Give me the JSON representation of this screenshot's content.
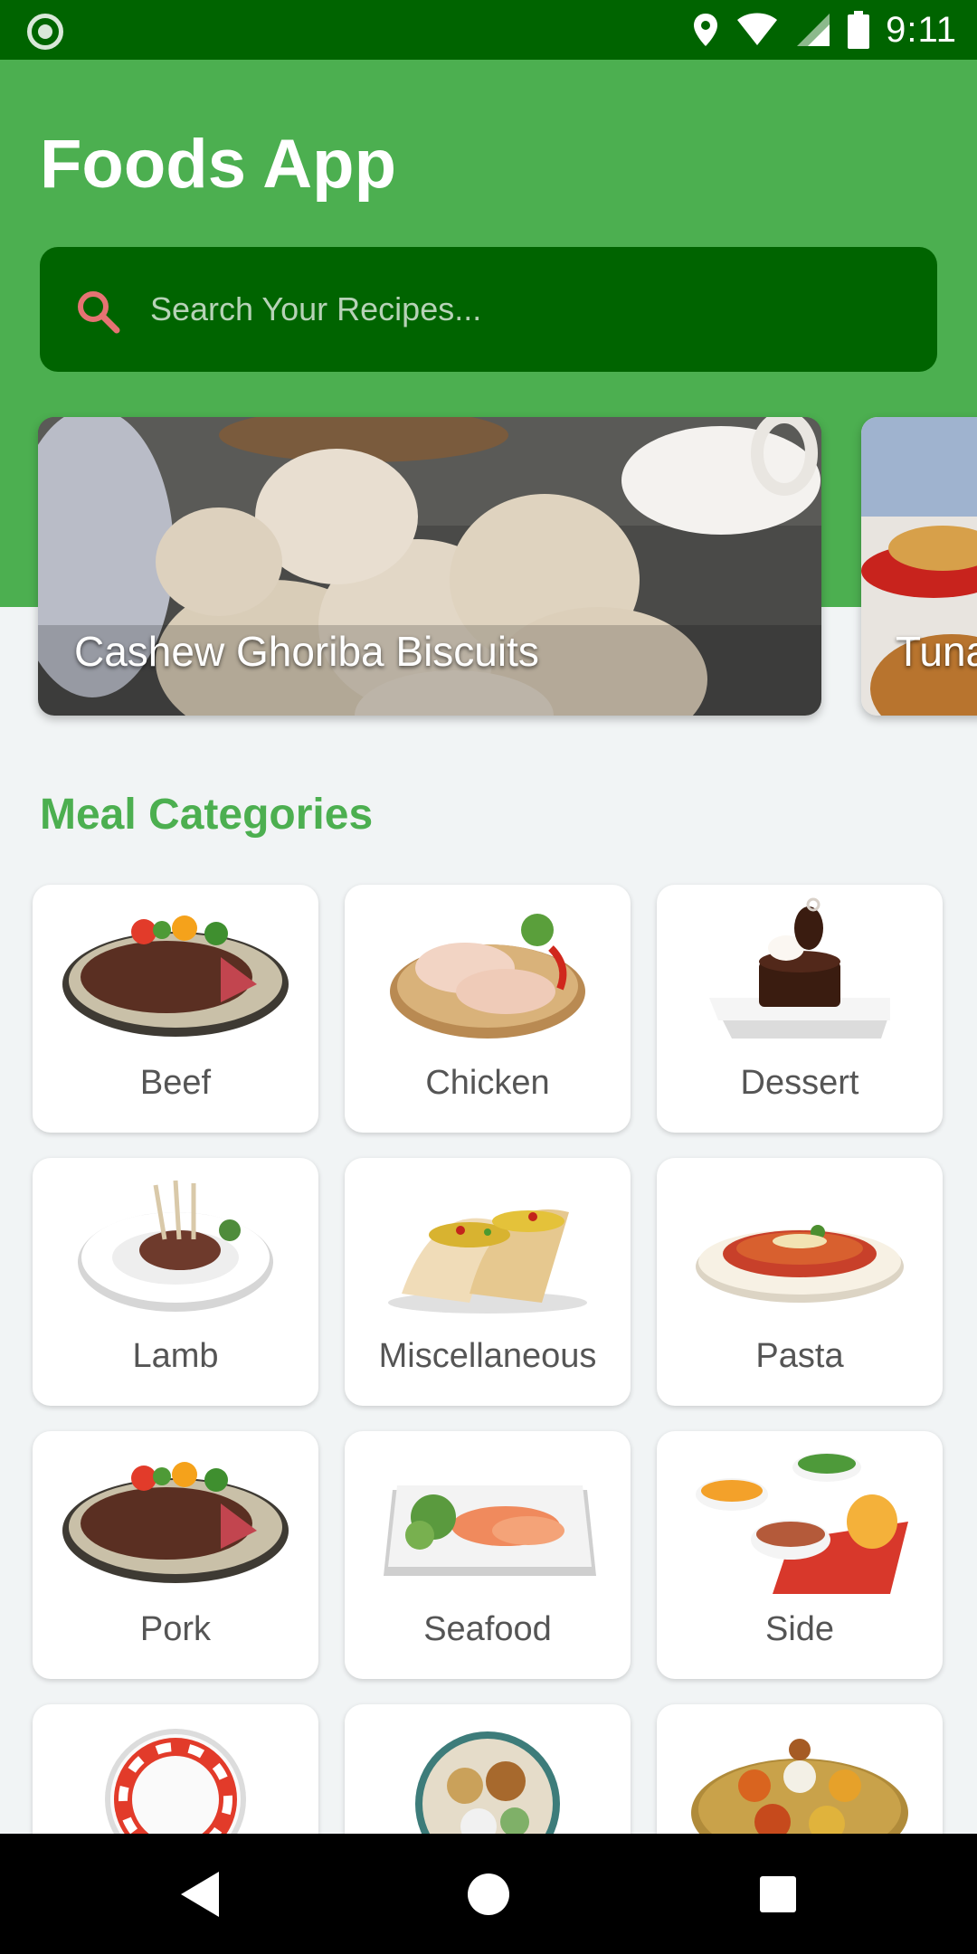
{
  "status_bar": {
    "time": "9:11",
    "left_icon": "notification-dot-icon",
    "right_icons": [
      "location-icon",
      "wifi-icon",
      "signal-icon",
      "battery-icon"
    ]
  },
  "header": {
    "title": "Foods App",
    "background_color": "#4caf50"
  },
  "search": {
    "placeholder": "Search Your Recipes...",
    "icon": "search-icon",
    "background_color": "#006400",
    "icon_color": "#e57373"
  },
  "carousel": [
    {
      "title": "Cashew Ghoriba Biscuits"
    },
    {
      "title": "Tuna"
    }
  ],
  "categories_section": {
    "title": "Meal Categories",
    "title_color": "#4caf50"
  },
  "categories": [
    {
      "label": "Beef"
    },
    {
      "label": "Chicken"
    },
    {
      "label": "Dessert"
    },
    {
      "label": "Lamb"
    },
    {
      "label": "Miscellaneous"
    },
    {
      "label": "Pasta"
    },
    {
      "label": "Pork"
    },
    {
      "label": "Seafood"
    },
    {
      "label": "Side"
    },
    {
      "label": ""
    },
    {
      "label": ""
    },
    {
      "label": ""
    }
  ],
  "nav_bar": {
    "buttons": [
      "back-icon",
      "home-icon",
      "recents-icon"
    ]
  }
}
